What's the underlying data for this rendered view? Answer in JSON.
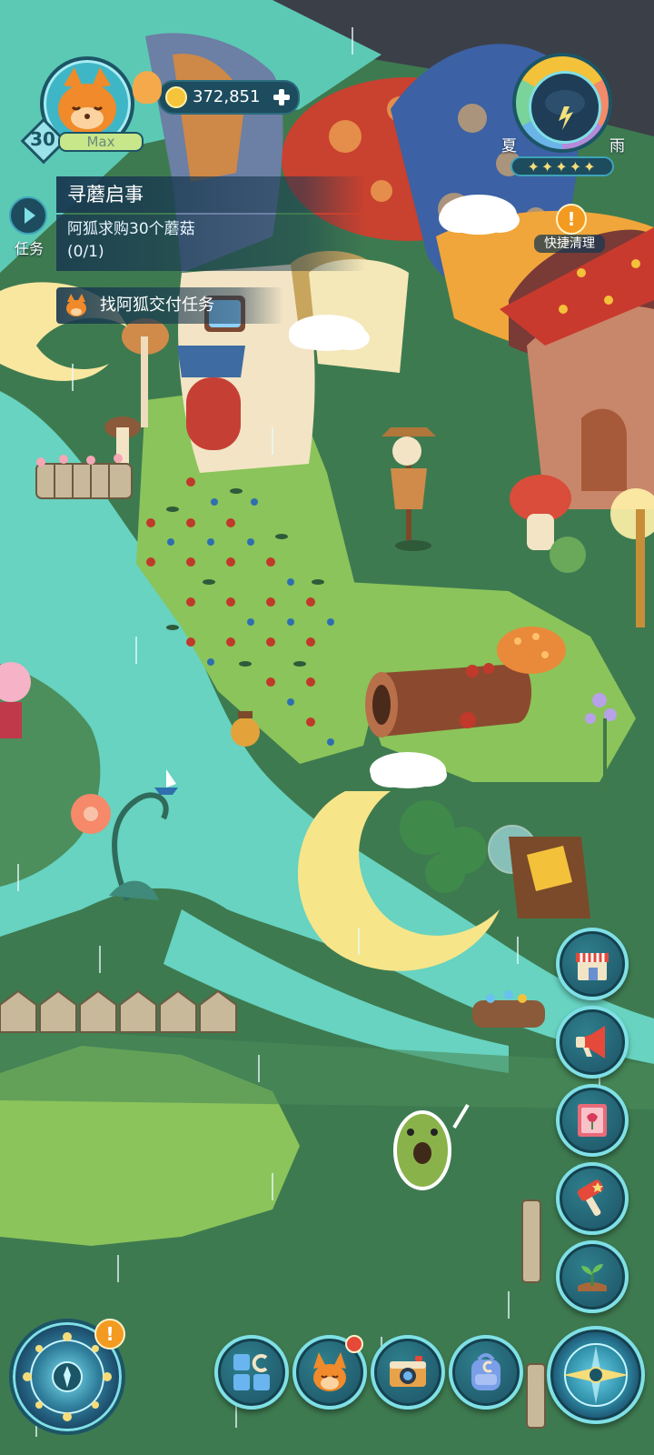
{
  "player": {
    "level": "30",
    "level_state": "Max",
    "avatar_icon": "fox-face-icon"
  },
  "currency": {
    "coins": "372,851",
    "add_icon": "plus-icon"
  },
  "task_tab": {
    "label": "任务"
  },
  "quest": {
    "title": "寻蘑启事",
    "description": "阿狐求购30个蘑菇",
    "progress": "(0/1)",
    "objective": "找阿狐交付任务"
  },
  "weather": {
    "season": "夏",
    "condition": "雨",
    "stars": 5,
    "quick_clean_label": "快捷清理"
  },
  "side_buttons": [
    {
      "name": "shop-button",
      "icon": "shop-icon"
    },
    {
      "name": "announce-button",
      "icon": "megaphone-icon"
    },
    {
      "name": "book-button",
      "icon": "tulip-book-icon"
    },
    {
      "name": "hammer-button",
      "icon": "hammer-icon"
    },
    {
      "name": "plant-button",
      "icon": "sprout-icon"
    }
  ],
  "dock": [
    {
      "name": "collection-button",
      "icon": "grid-c-icon"
    },
    {
      "name": "fox-button",
      "icon": "fox-icon"
    },
    {
      "name": "camera-button",
      "icon": "camera-icon"
    },
    {
      "name": "backpack-button",
      "icon": "backpack-icon"
    }
  ],
  "colors": {
    "river": "#67d3c0",
    "grass": "#8bc45a",
    "dark_grass": "#3e7a50",
    "accent_orange": "#f39a21",
    "panel": "#183850"
  }
}
